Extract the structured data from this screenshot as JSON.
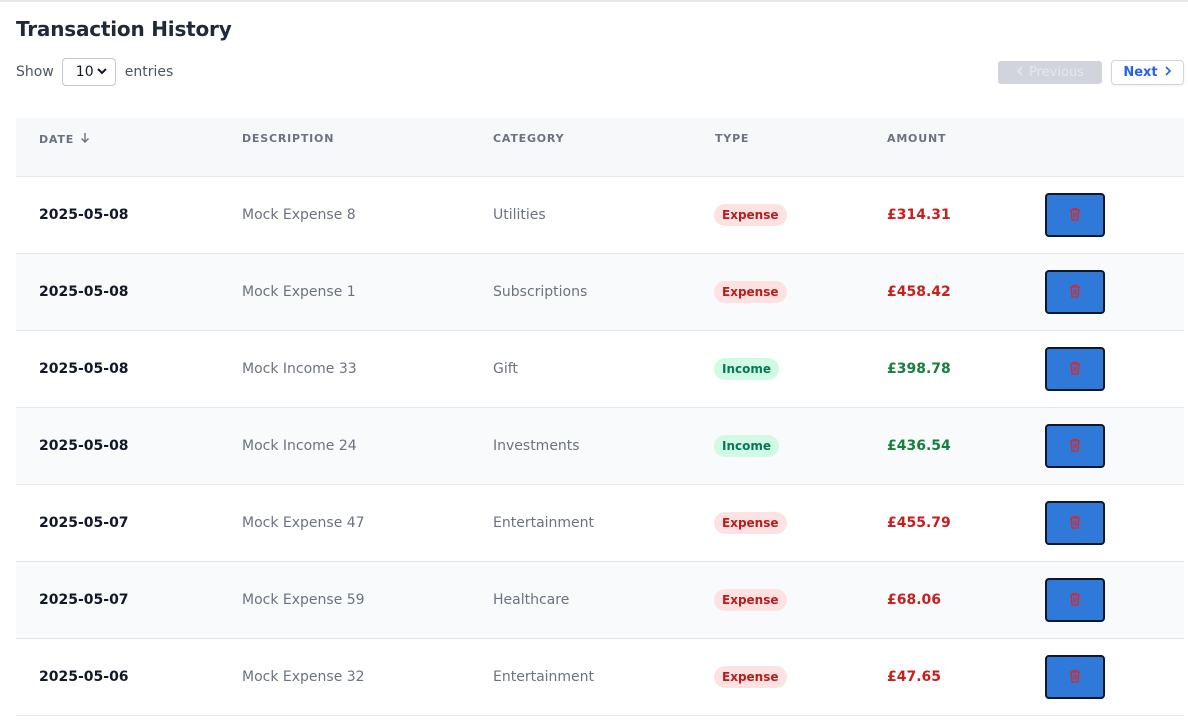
{
  "title": "Transaction History",
  "controls": {
    "show_label": "Show",
    "entries_value": "10",
    "entries_label": "entries",
    "prev_label": "Previous",
    "next_label": "Next"
  },
  "columns": {
    "date": "DATE",
    "description": "DESCRIPTION",
    "category": "CATEGORY",
    "type": "TYPE",
    "amount": "AMOUNT"
  },
  "colors": {
    "expense": "#c81e1e",
    "income": "#15803d",
    "delete_button": "#2f7ad8"
  },
  "rows": [
    {
      "date": "2025-05-08",
      "description": "Mock Expense 8",
      "category": "Utilities",
      "type": "Expense",
      "amount": "£314.31"
    },
    {
      "date": "2025-05-08",
      "description": "Mock Expense 1",
      "category": "Subscriptions",
      "type": "Expense",
      "amount": "£458.42"
    },
    {
      "date": "2025-05-08",
      "description": "Mock Income 33",
      "category": "Gift",
      "type": "Income",
      "amount": "£398.78"
    },
    {
      "date": "2025-05-08",
      "description": "Mock Income 24",
      "category": "Investments",
      "type": "Income",
      "amount": "£436.54"
    },
    {
      "date": "2025-05-07",
      "description": "Mock Expense 47",
      "category": "Entertainment",
      "type": "Expense",
      "amount": "£455.79"
    },
    {
      "date": "2025-05-07",
      "description": "Mock Expense 59",
      "category": "Healthcare",
      "type": "Expense",
      "amount": "£68.06"
    },
    {
      "date": "2025-05-06",
      "description": "Mock Expense 32",
      "category": "Entertainment",
      "type": "Expense",
      "amount": "£47.65"
    }
  ]
}
